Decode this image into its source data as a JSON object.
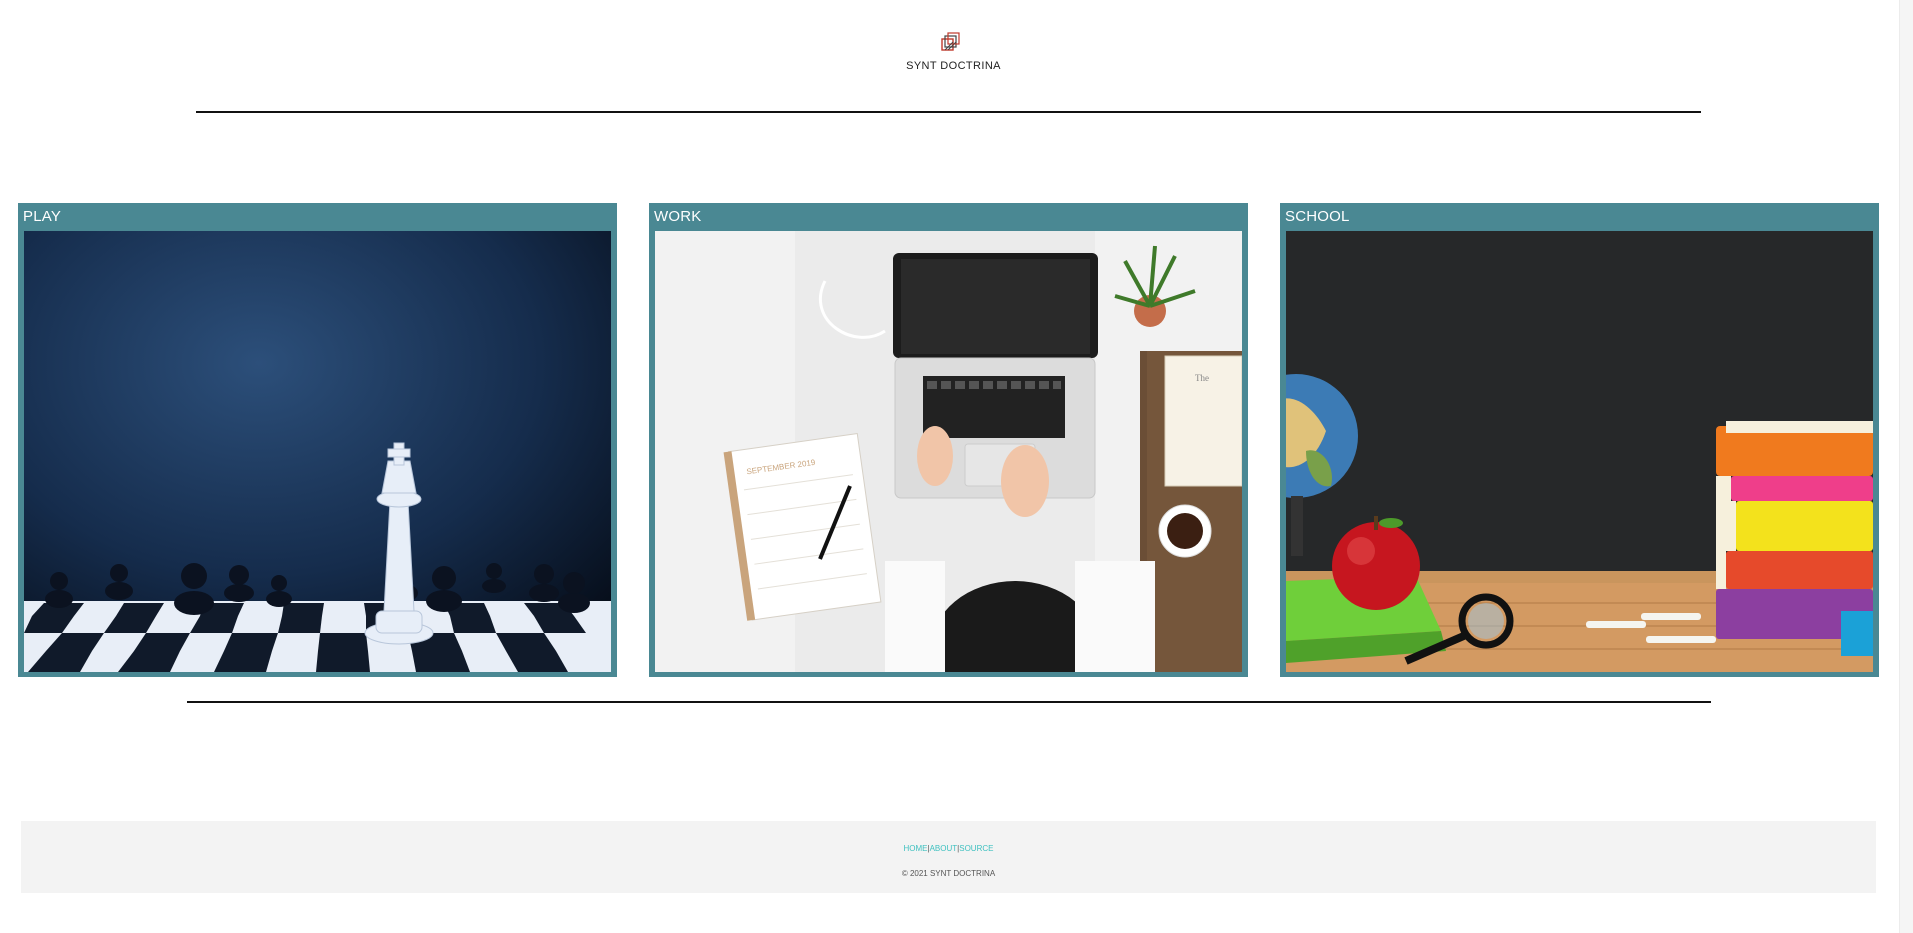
{
  "header": {
    "brand": "SYNT DOCTRINA",
    "logo_icon": "stacked-squares-logo-icon"
  },
  "cards": [
    {
      "label": "PLAY",
      "image": "chess-king-photo"
    },
    {
      "label": "WORK",
      "image": "laptop-desk-photo"
    },
    {
      "label": "SCHOOL",
      "image": "chalkboard-apple-books-photo"
    }
  ],
  "footer": {
    "links": [
      "HOME",
      "ABOUT",
      "SOURCE"
    ],
    "separator": "|",
    "copyright": "© 2021 SYNT DOCTRINA"
  },
  "colors": {
    "card_frame": "#4a8893",
    "footer_bg": "#f3f3f3",
    "footer_link": "#3fc1c0",
    "logo_red": "#c0392b"
  }
}
